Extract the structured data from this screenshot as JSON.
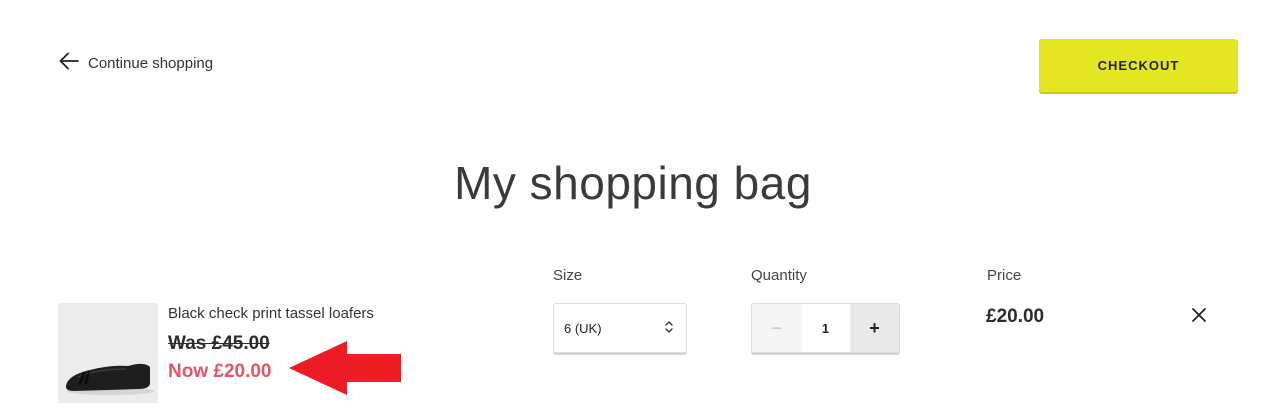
{
  "header": {
    "continue_label": "Continue shopping",
    "checkout_label": "CHECKOUT"
  },
  "page_title": "My shopping bag",
  "columns": {
    "size": "Size",
    "quantity": "Quantity",
    "price": "Price"
  },
  "item": {
    "name": "Black check print tassel loafers",
    "was_price": "Was £45.00",
    "now_price": "Now £20.00",
    "size": "6 (UK)",
    "quantity": "1",
    "minus": "−",
    "plus": "+",
    "line_price": "£20.00"
  },
  "colors": {
    "checkout_bg": "#e4e622",
    "sale_price": "#e2566a",
    "annotation_arrow": "#ee1c24"
  }
}
